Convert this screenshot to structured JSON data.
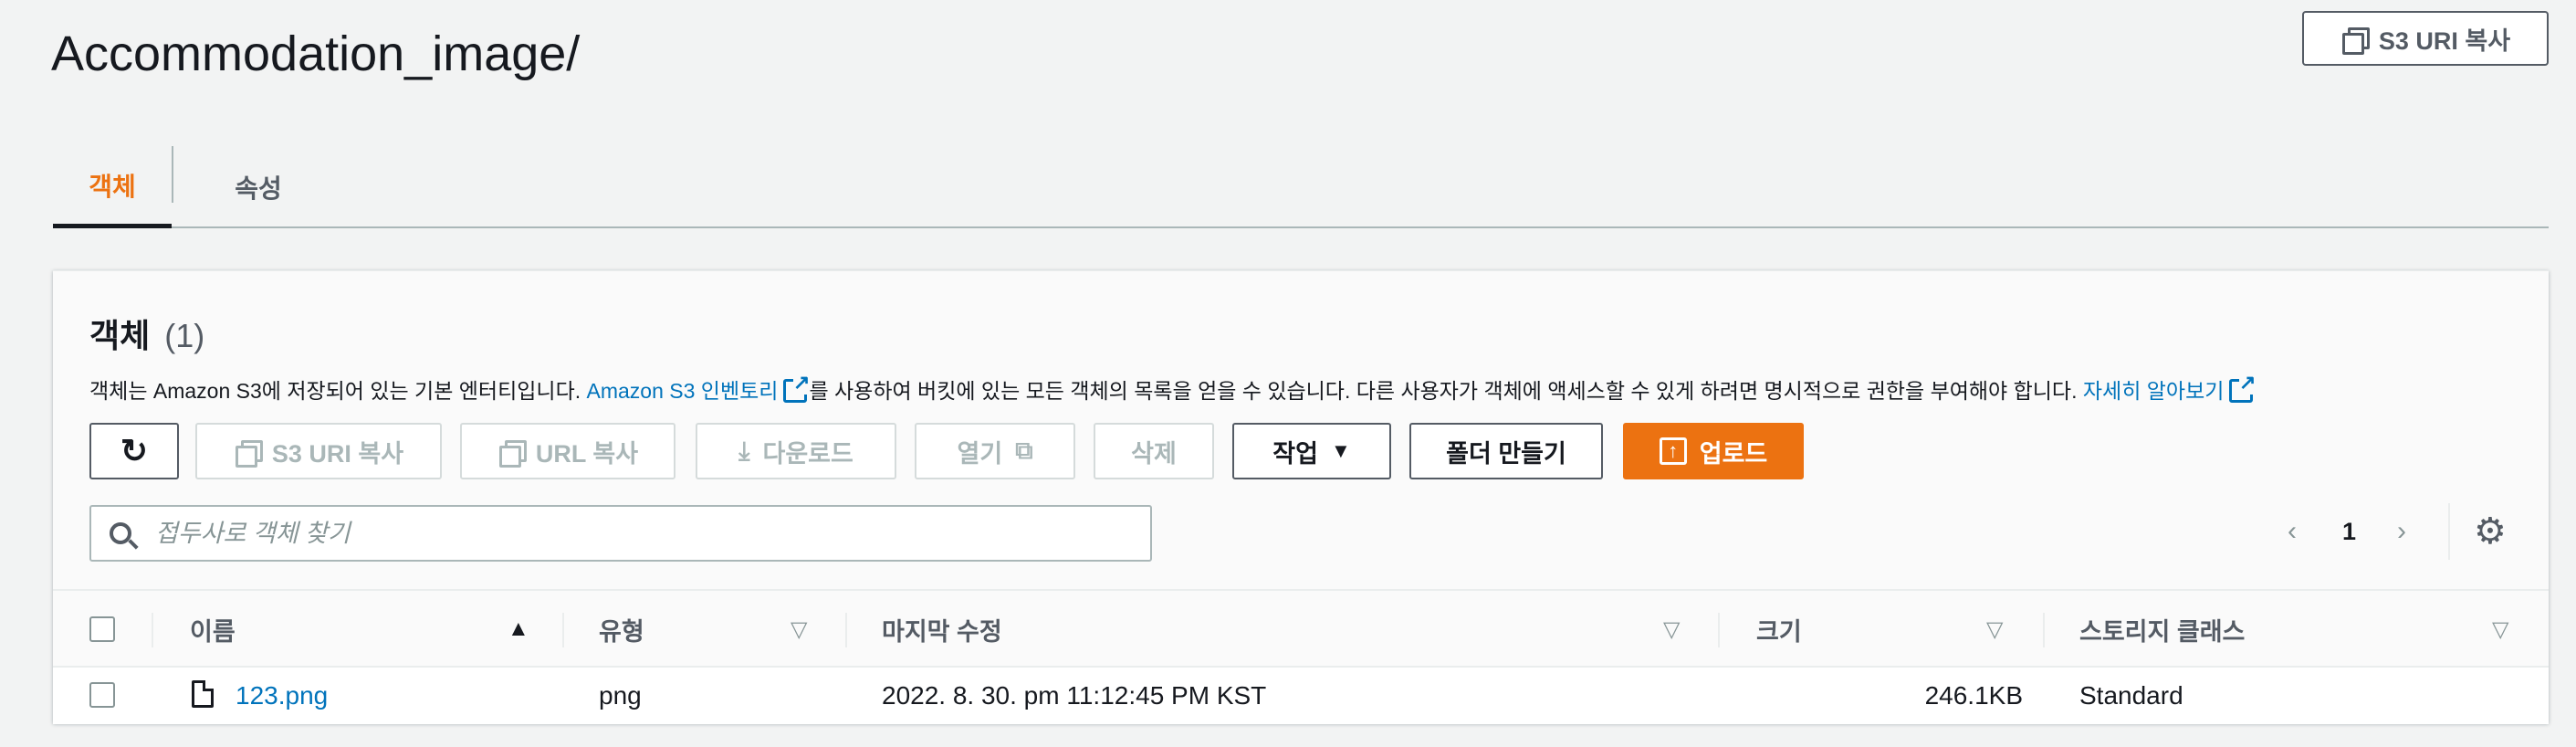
{
  "page": {
    "title": "Accommodation_image/"
  },
  "header_actions": {
    "copy_s3_uri": "S3 URI 복사"
  },
  "tabs": [
    {
      "label": "객체",
      "active": true
    },
    {
      "label": "속성",
      "active": false
    }
  ],
  "objects_panel": {
    "title": "객체",
    "count": "(1)",
    "description": {
      "part1": "객체는 Amazon S3에 저장되어 있는 기본 엔터티입니다. ",
      "link1": "Amazon S3 인벤토리",
      "part2": "를 사용하여 버킷에 있는 모든 객체의 목록을 얻을 수 있습니다. 다른 사용자가 객체에 액세스할 수 있게 하려면 명시적으로 권한을 부여해야 합니다. ",
      "link2": "자세히 알아보기"
    },
    "toolbar": {
      "copy_s3_uri": "S3 URI 복사",
      "copy_url": "URL 복사",
      "download": "다운로드",
      "open": "열기",
      "delete": "삭제",
      "actions": "작업",
      "create_folder": "폴더 만들기",
      "upload": "업로드"
    },
    "search": {
      "placeholder": "접두사로 객체 찾기",
      "value": ""
    },
    "pagination": {
      "current_page": "1"
    }
  },
  "table": {
    "columns": [
      "이름",
      "유형",
      "마지막 수정",
      "크기",
      "스토리지 클래스"
    ],
    "rows": [
      {
        "name": "123.png",
        "type": "png",
        "last_modified": "2022. 8. 30. pm 11:12:45 PM KST",
        "size": "246.1KB",
        "storage_class": "Standard"
      }
    ]
  },
  "colors": {
    "accent": "#ec7211",
    "link": "#0073bb",
    "text": "#16191f",
    "muted": "#545b64"
  }
}
